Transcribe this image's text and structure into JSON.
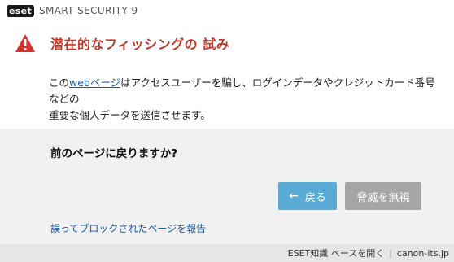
{
  "titlebar": {
    "logo_text": "eset",
    "product": "SMART SECURITY 9"
  },
  "warning": {
    "icon": "warning-triangle-icon",
    "title": "潜在的なフィッシングの 試み"
  },
  "description": {
    "prefix": "この",
    "link": "webページ",
    "line1_rest": "はアクセスユーザーを騙し、ログインデータやクレジットカード番号などの",
    "line2": "重要な個人データを送信させます。"
  },
  "question": "前のページに戻りますか?",
  "buttons": {
    "back_label": "戻る",
    "back_icon": "arrow-left-icon",
    "ignore_label": "脅威を無視"
  },
  "report_link": "誤ってブロックされたページを報告",
  "footer": {
    "kb_link": "ESET知識 ベースを開く",
    "separator": "|",
    "domain": "canon-its.jp"
  },
  "colors": {
    "title_red": "#c0392b",
    "back_button": "#5aaad6",
    "ignore_button": "#a6a6a6",
    "link_blue": "#1a5aa6"
  }
}
